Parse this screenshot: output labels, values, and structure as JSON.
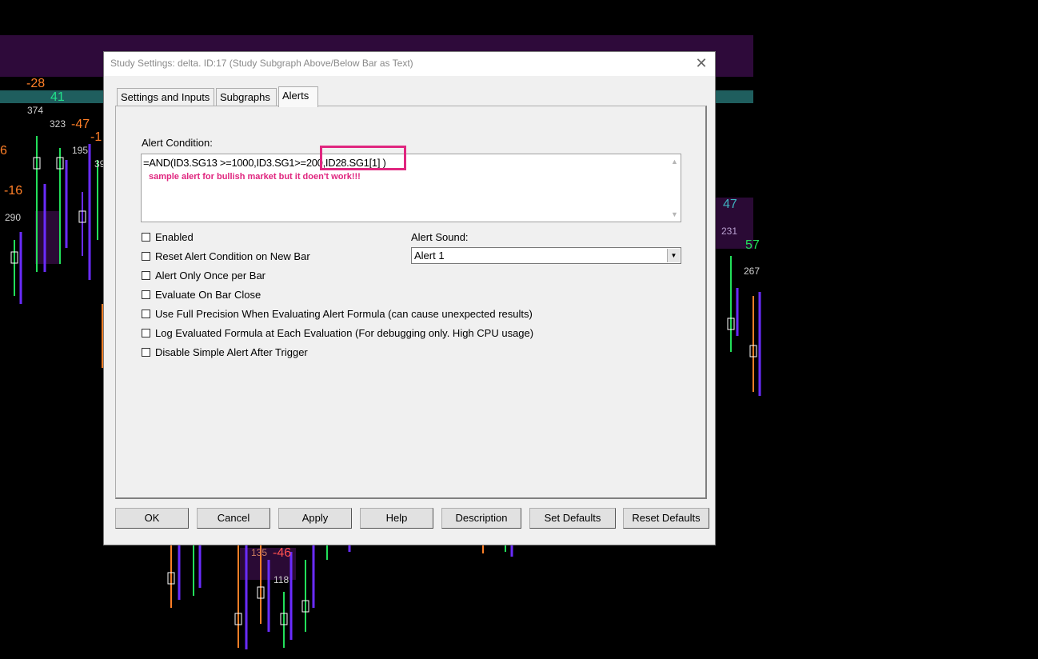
{
  "chart": {
    "value_labels": [
      {
        "text": "-28",
        "color": "#ff7f27"
      },
      {
        "text": "41",
        "color": "#22e08a"
      },
      {
        "text": "374",
        "color": "#d0d0d0"
      },
      {
        "text": "323",
        "color": "#d0d0d0"
      },
      {
        "text": "-47",
        "color": "#ff7f27"
      },
      {
        "text": "-1",
        "color": "#ff7f27"
      },
      {
        "text": "195",
        "color": "#d0d0d0"
      },
      {
        "text": "39",
        "color": "#d0d0d0"
      },
      {
        "text": "6",
        "color": "#ff7f27"
      },
      {
        "text": "-16",
        "color": "#ff7f27"
      },
      {
        "text": "290",
        "color": "#d0d0d0"
      },
      {
        "text": "47",
        "color": "#3fb3c0"
      },
      {
        "text": "231",
        "color": "#b9a0d0"
      },
      {
        "text": "57",
        "color": "#22e05a"
      },
      {
        "text": "267",
        "color": "#d0d0d0"
      },
      {
        "text": "135",
        "color": "#d08060"
      },
      {
        "text": "-46",
        "color": "#ff5050"
      },
      {
        "text": "118",
        "color": "#d0d0d0"
      }
    ]
  },
  "dialog": {
    "title": "Study Settings: delta. ID:17 (Study Subgraph Above/Below Bar as Text)",
    "close_glyph": "✕",
    "tabs": [
      {
        "label": "Settings and Inputs",
        "active": false
      },
      {
        "label": "Subgraphs",
        "active": false
      },
      {
        "label": "Alerts",
        "active": true
      }
    ],
    "alert_condition": {
      "label": "Alert Condition:",
      "formula": "=AND(ID3.SG13 >=1000,ID3.SG1>=200,ID28.SG1[1] )",
      "annotation": "sample alert for bullish market but it doen't work!!!",
      "annotation_color": "#e0267f"
    },
    "checkboxes": [
      {
        "label": "Enabled",
        "checked": false
      },
      {
        "label": "Reset Alert Condition on New Bar",
        "checked": false
      },
      {
        "label": "Alert Only Once per Bar",
        "checked": false
      },
      {
        "label": "Evaluate On Bar Close",
        "checked": false
      },
      {
        "label": "Use Full Precision When Evaluating Alert Formula (can cause unexpected results)",
        "checked": false
      },
      {
        "label": "Log Evaluated Formula at Each Evaluation (For debugging only. High CPU usage)",
        "checked": false
      },
      {
        "label": "Disable Simple Alert After Trigger",
        "checked": false
      }
    ],
    "alert_sound": {
      "label": "Alert Sound:",
      "value": "Alert 1"
    },
    "buttons": {
      "ok": "OK",
      "cancel": "Cancel",
      "apply": "Apply",
      "help": "Help",
      "description": "Description",
      "set_defaults": "Set Defaults",
      "reset_defaults": "Reset Defaults"
    }
  }
}
